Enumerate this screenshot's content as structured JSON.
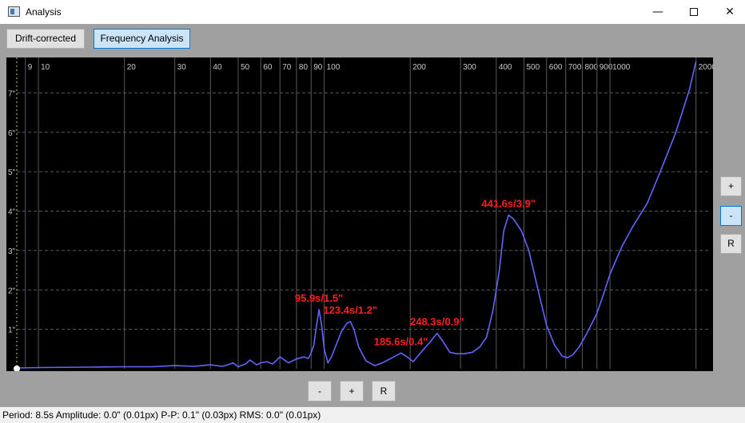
{
  "window": {
    "title": "Analysis",
    "minimize": "—",
    "close": "✕"
  },
  "tabs": {
    "drift": "Drift-corrected",
    "frequency": "Frequency Analysis"
  },
  "side_buttons": {
    "plus": "+",
    "minus": "-",
    "reset": "R"
  },
  "bottom_buttons": {
    "minus": "-",
    "plus": "+",
    "reset": "R"
  },
  "status": {
    "text": "Period: 8.5s  Amplitude: 0.0\" (0.01px)  P-P: 0.1\" (0.03px)  RMS: 0.0\" (0.01px)"
  },
  "colors": {
    "background": "#000000",
    "curve": "#6464ff",
    "grid": "#5a5a5a",
    "label": "#ff2020",
    "tick_text": "#c8c8c8"
  },
  "chart_data": {
    "type": "line",
    "xscale": "log",
    "xlim": [
      8.4,
      2250
    ],
    "ylim": [
      0,
      7.9
    ],
    "x_ticks": [
      9,
      10,
      20,
      30,
      40,
      50,
      60,
      70,
      80,
      90,
      100,
      200,
      300,
      400,
      500,
      600,
      700,
      800,
      900,
      1000,
      2000
    ],
    "x_tick_labels": [
      "9",
      "10",
      "20",
      "30",
      "40",
      "50",
      "60",
      "70",
      "80",
      "90",
      "100",
      "200",
      "300",
      "400",
      "500",
      "600",
      "700",
      "800",
      "900",
      "1000",
      "2000"
    ],
    "y_ticks": [
      1,
      2,
      3,
      4,
      5,
      6,
      7
    ],
    "y_tick_labels": [
      "1\"",
      "2\"",
      "3\"",
      "4\"",
      "5\"",
      "6\"",
      "7\""
    ],
    "series": [
      {
        "x": [
          8.5,
          10,
          15,
          20,
          25,
          30,
          35,
          40,
          44,
          46,
          48,
          50,
          53,
          55,
          58,
          60,
          63,
          66,
          70,
          75,
          80,
          85,
          88,
          90,
          92,
          94,
          95.9,
          98,
          100,
          103,
          106,
          110,
          115,
          120,
          123.4,
          127,
          132,
          140,
          150,
          160,
          175,
          185.6,
          195,
          205,
          220,
          235,
          248.3,
          260,
          275,
          290,
          310,
          330,
          350,
          370,
          390,
          410,
          425,
          441.6,
          460,
          490,
          520,
          560,
          600,
          640,
          680,
          710,
          740,
          780,
          830,
          900,
          950,
          1000,
          1100,
          1200,
          1350,
          1500,
          1700,
          1900,
          2000
        ],
        "y": [
          0.02,
          0.03,
          0.04,
          0.05,
          0.05,
          0.08,
          0.06,
          0.1,
          0.06,
          0.1,
          0.15,
          0.05,
          0.12,
          0.22,
          0.1,
          0.15,
          0.18,
          0.12,
          0.3,
          0.15,
          0.25,
          0.3,
          0.26,
          0.4,
          0.6,
          1.1,
          1.5,
          1.1,
          0.5,
          0.15,
          0.3,
          0.6,
          0.95,
          1.15,
          1.2,
          1.0,
          0.55,
          0.2,
          0.08,
          0.15,
          0.3,
          0.4,
          0.3,
          0.18,
          0.45,
          0.68,
          0.9,
          0.7,
          0.42,
          0.38,
          0.38,
          0.42,
          0.55,
          0.8,
          1.5,
          2.5,
          3.5,
          3.9,
          3.8,
          3.5,
          3.0,
          2.0,
          1.1,
          0.6,
          0.32,
          0.28,
          0.35,
          0.55,
          0.9,
          1.4,
          1.9,
          2.4,
          3.1,
          3.6,
          4.2,
          5.0,
          6.0,
          7.1,
          7.8
        ]
      }
    ],
    "annotations": [
      {
        "x": 95.9,
        "y": 1.5,
        "text": "95.9s/1.5\""
      },
      {
        "x": 123.4,
        "y": 1.2,
        "text": "123.4s/1.2\""
      },
      {
        "x": 185.6,
        "y": 0.4,
        "text": "185.6s/0.4\""
      },
      {
        "x": 248.3,
        "y": 0.9,
        "text": "248.3s/0.9\""
      },
      {
        "x": 441.6,
        "y": 3.9,
        "text": "441.6s/3.9\""
      }
    ],
    "grid": true
  }
}
